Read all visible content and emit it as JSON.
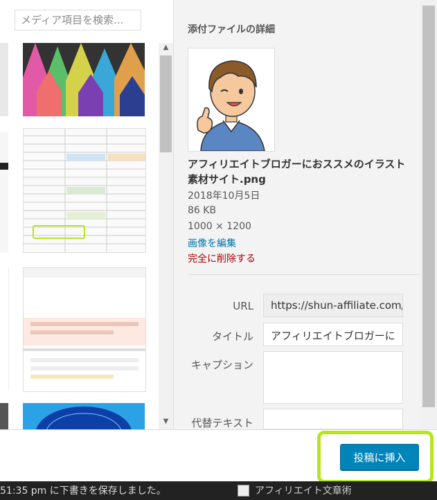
{
  "library": {
    "search_placeholder": "メディア項目を検索..."
  },
  "details": {
    "title": "添付ファイルの詳細",
    "filename": "アフィリエイトブロガーにおススメのイラスト素材サイト.png",
    "date": "2018年10月5日",
    "size": "86 KB",
    "dimensions": "1000 × 1200",
    "edit_image": "画像を編集",
    "delete_permanently": "完全に削除する"
  },
  "fields": {
    "url_label": "URL",
    "url_value": "https://shun-affiliate.com/w",
    "title_label": "タイトル",
    "title_value": "アフィリエイトブロガーに",
    "caption_label": "キャプション",
    "alt_label": "代替テキスト"
  },
  "toolbar": {
    "insert_label": "投稿に挿入"
  },
  "background": {
    "status_text": "51:35 pm に下書きを保存しました。",
    "right_text": "アフィリエイト文章術"
  },
  "colors": {
    "primary_button": "#0085ba",
    "highlight": "#b5e61d",
    "link": "#0073aa",
    "delete": "#aa0000"
  }
}
